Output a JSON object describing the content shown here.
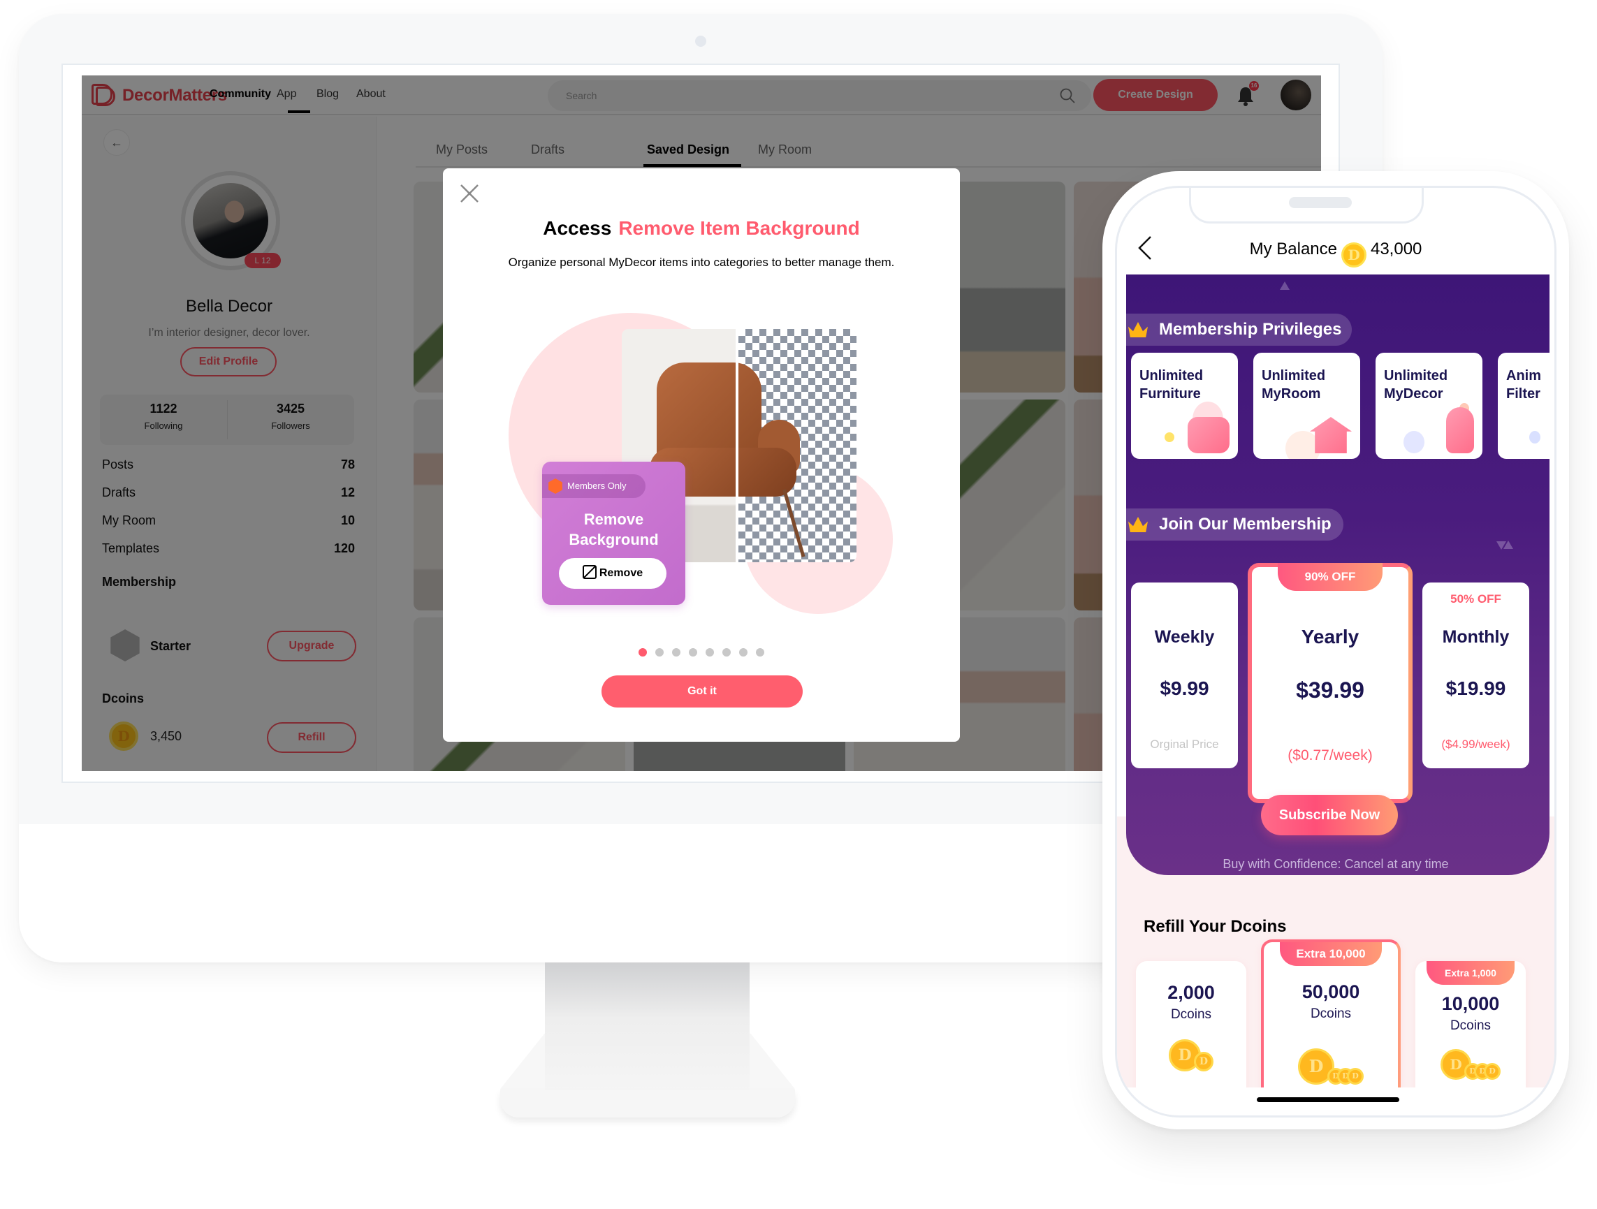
{
  "desktop": {
    "brand": "DecorMatters",
    "nav": {
      "links": [
        "Community",
        "App",
        "Blog",
        "About"
      ],
      "active": "Community",
      "search_placeholder": "Search",
      "create_button": "Create Design",
      "notification_count": "16"
    },
    "profile": {
      "level": "L 12",
      "name": "Bella Decor",
      "bio": "I’m interior designer, decor lover.",
      "edit_button": "Edit Profile",
      "following": {
        "count": "1122",
        "label": "Following"
      },
      "followers": {
        "count": "3425",
        "label": "Followers"
      },
      "counts": [
        {
          "label": "Posts",
          "value": "78"
        },
        {
          "label": "Drafts",
          "value": "12"
        },
        {
          "label": "My Room",
          "value": "10"
        },
        {
          "label": "Templates",
          "value": "120"
        }
      ],
      "membership": {
        "title": "Membership",
        "tier": "Starter",
        "button": "Upgrade"
      },
      "dcoins": {
        "title": "Dcoins",
        "amount": "3,450",
        "button": "Refill"
      }
    },
    "tabs": [
      "My Posts",
      "Drafts",
      "Saved Design",
      "My Room"
    ],
    "active_tab": "Saved Design",
    "modal": {
      "title_prefix": "Access",
      "title_accent": "Remove Item Background",
      "subtitle": "Organize personal MyDecor items into categories to better manage them.",
      "promo": {
        "badge": "Members Only",
        "title_line1": "Remove",
        "title_line2": "Background",
        "button": "Remove"
      },
      "pagination": {
        "total": 8,
        "current": 1
      },
      "confirm_button": "Got it",
      "accent_color": "#ff5b6e"
    }
  },
  "phone": {
    "header": {
      "title": "My Balance",
      "balance": "43,000"
    },
    "privileges": {
      "title": "Membership Privileges",
      "items": [
        {
          "line1": "Unlimited",
          "line2": "Furniture",
          "icon": "sofa-icon"
        },
        {
          "line1": "Unlimited",
          "line2": "MyRoom",
          "icon": "house-icon"
        },
        {
          "line1": "Unlimited",
          "line2": "MyDecor",
          "icon": "vase-icon"
        },
        {
          "line1": "Anim",
          "line2": "Filter",
          "icon": "filter-icon"
        }
      ]
    },
    "membership": {
      "title": "Join Our Membership",
      "plans": [
        {
          "name": "Weekly",
          "price": "$9.99",
          "badge": "",
          "note": "Orginal Price"
        },
        {
          "name": "Yearly",
          "price": "$39.99",
          "badge": "90% OFF",
          "note": "($0.77/week)"
        },
        {
          "name": "Monthly",
          "price": "$19.99",
          "badge": "50% OFF",
          "note": "($4.99/week)"
        }
      ],
      "subscribe_button": "Subscribe Now",
      "confidence": "Buy with Confidence: Cancel at any time"
    },
    "refill": {
      "title": "Refill Your Dcoins",
      "packs": [
        {
          "amount": "2,000",
          "unit": "Dcoins",
          "extra": ""
        },
        {
          "amount": "50,000",
          "unit": "Dcoins",
          "extra": "Extra 10,000"
        },
        {
          "amount": "10,000",
          "unit": "Dcoins",
          "extra": "Extra 1,000"
        }
      ]
    }
  },
  "colors": {
    "brand": "#e8414d",
    "accent_pink": "#ff5563",
    "phone_purple": "#3e1677",
    "navy_text": "#1b1551"
  }
}
